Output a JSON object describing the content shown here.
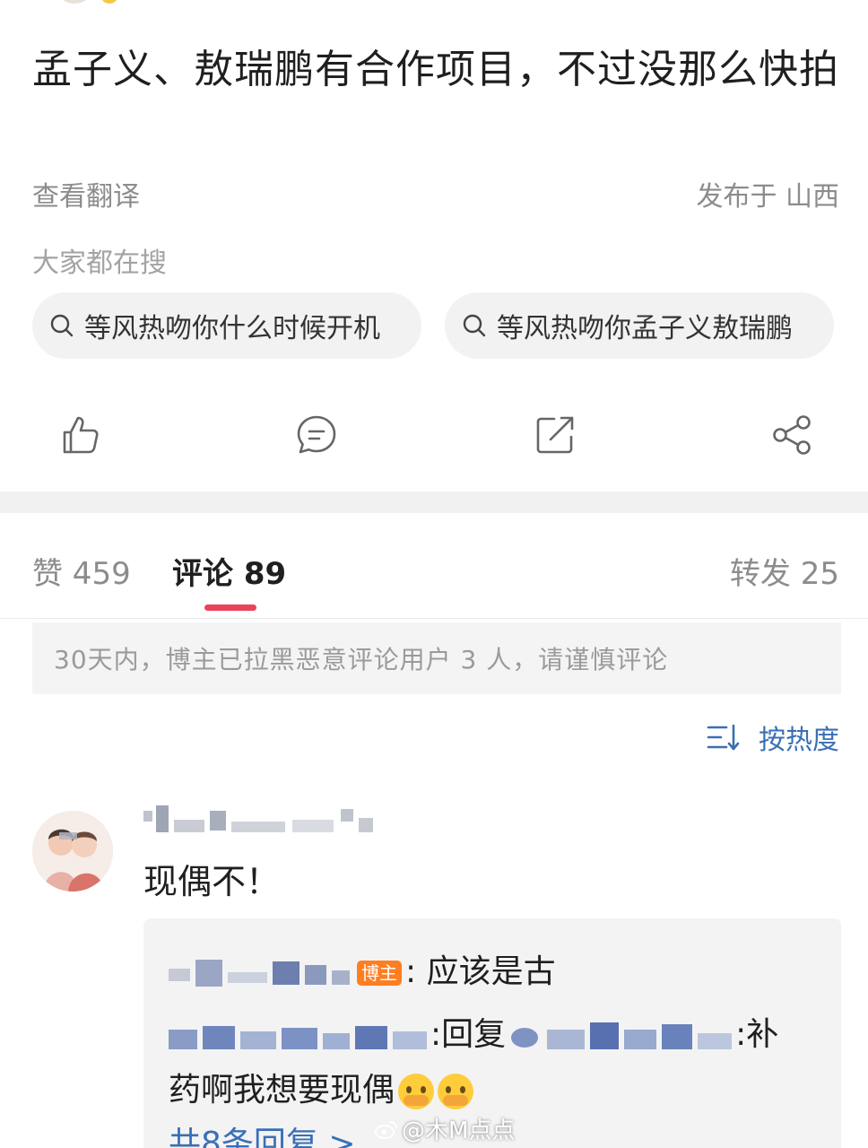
{
  "post": {
    "title": "孟子义、敖瑞鹏有合作项目，不过没那么快拍",
    "translate": "查看翻译",
    "location": "发布于 山西"
  },
  "search": {
    "heading": "大家都在搜",
    "chips": [
      "等风热吻你什么时候开机",
      "等风热吻你孟子义敖瑞鹏"
    ]
  },
  "actions": {
    "icons": [
      "like-icon",
      "comment-icon",
      "repost-icon",
      "share-icon"
    ]
  },
  "tabs": {
    "likes": "赞 459",
    "comments": "评论 89",
    "reposts": "转发 25",
    "accent": "#e8445a"
  },
  "notice": "30天内，博主已拉黑恶意评论用户 3 人，请谨慎评论",
  "sort": {
    "label": "按热度",
    "icon": "sort-icon"
  },
  "comment": {
    "text": "现偶不！",
    "replies": {
      "host_tag": "博主",
      "reply1": ": 应该是古",
      "reply2_prefix": ":回复",
      "reply2_suffix": ":补",
      "reply2_cont": "药啊我想要现偶",
      "more": "共8条回复 >"
    }
  },
  "watermark": "@木M点点",
  "colors": {
    "link": "#3a6fb5",
    "host_tag": "#ff7e21"
  }
}
